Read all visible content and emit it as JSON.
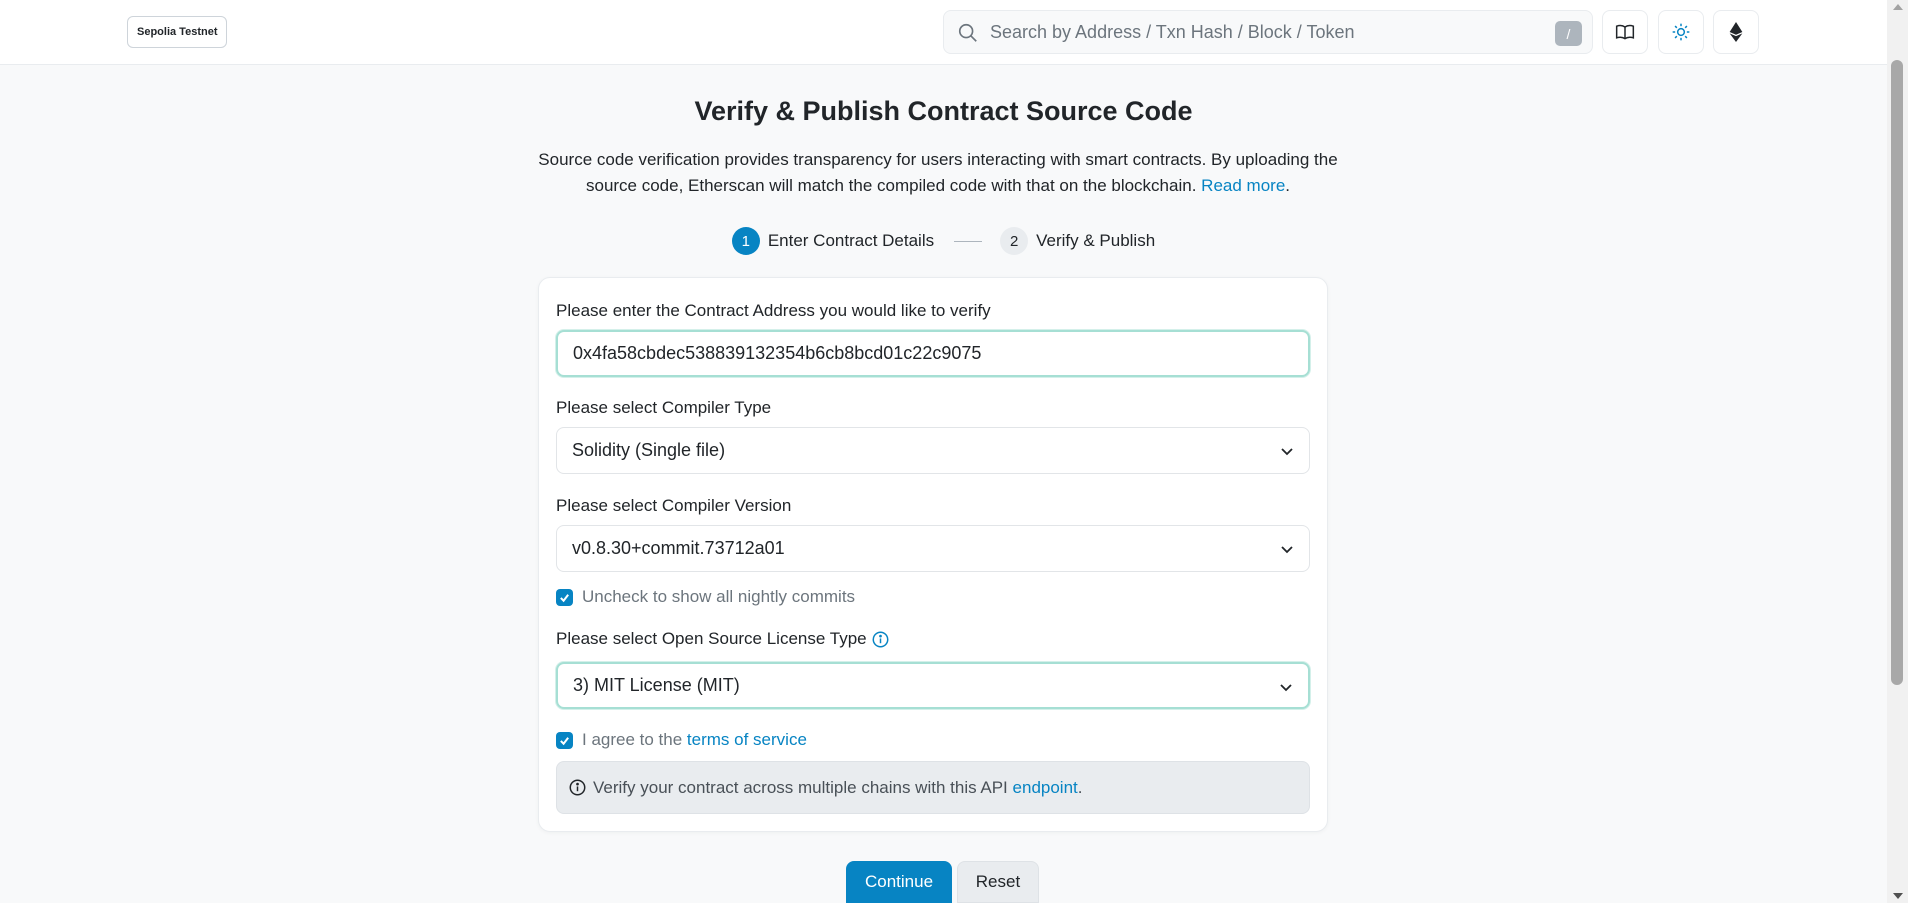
{
  "header": {
    "network_badge": "Sepolia Testnet",
    "search_placeholder": "Search by Address / Txn Hash / Block / Token",
    "search_shortcut": "/",
    "icons": [
      "book-icon",
      "sun-icon",
      "ethereum-icon"
    ]
  },
  "page": {
    "title": "Verify & Publish Contract Source Code",
    "intro_text": "Source code verification provides transparency for users interacting with smart contracts. By uploading the source code, Etherscan will match the compiled code with that on the blockchain.",
    "read_more": "Read more",
    "intro_end": "."
  },
  "steps": [
    {
      "number": "1",
      "label": "Enter Contract Details",
      "active": true
    },
    {
      "number": "2",
      "label": "Verify & Publish",
      "active": false
    }
  ],
  "form": {
    "address_label": "Please enter the Contract Address you would like to verify",
    "address_value": "0x4fa58cbdec538839132354b6cb8bcd01c22c9075",
    "compiler_type_label": "Please select Compiler Type",
    "compiler_type_value": "Solidity (Single file)",
    "compiler_version_label": "Please select Compiler Version",
    "compiler_version_value": "v0.8.30+commit.73712a01",
    "nightly_label": "Uncheck to show all nightly commits",
    "nightly_checked": true,
    "license_label": "Please select Open Source License Type",
    "license_value": "3) MIT License (MIT)",
    "agree_prefix": "I agree to the",
    "agree_link": "terms of service",
    "agree_checked": true,
    "info_prefix": "Verify your contract across multiple chains with this API",
    "info_link": "endpoint",
    "info_suffix": "."
  },
  "actions": {
    "continue_label": "Continue",
    "reset_label": "Reset"
  },
  "colors": {
    "accent": "#0784c3",
    "focus_border": "#a6dfd4",
    "info_bg": "#e9ecef"
  }
}
